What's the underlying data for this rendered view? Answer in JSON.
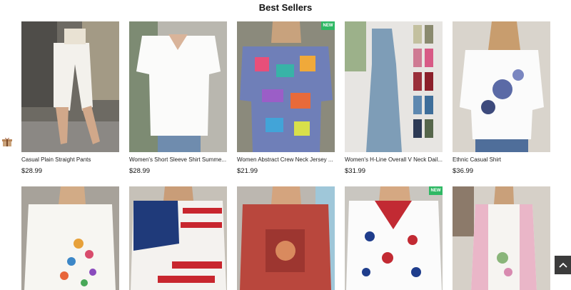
{
  "section": {
    "title": "Best Sellers"
  },
  "products": [
    {
      "name": "Casual Plain Straight Pants",
      "price": "$28.99",
      "badge": ""
    },
    {
      "name": "Women's Short Sleeve Shirt Summe...",
      "price": "$28.99",
      "badge": ""
    },
    {
      "name": "Women Abstract Crew Neck Jersey ...",
      "price": "$21.99",
      "badge": "NEW"
    },
    {
      "name": "Women's H-Line Overall V Neck Dail...",
      "price": "$31.99",
      "badge": ""
    },
    {
      "name": "Ethnic Casual Shirt",
      "price": "$36.99",
      "badge": ""
    },
    {
      "name": "",
      "price": "",
      "badge": ""
    },
    {
      "name": "",
      "price": "",
      "badge": ""
    },
    {
      "name": "",
      "price": "",
      "badge": ""
    },
    {
      "name": "",
      "price": "",
      "badge": "NEW"
    },
    {
      "name": "",
      "price": "",
      "badge": ""
    }
  ],
  "icons": {
    "gift": "gift-icon",
    "back_to_top": "chevron-up-icon"
  }
}
